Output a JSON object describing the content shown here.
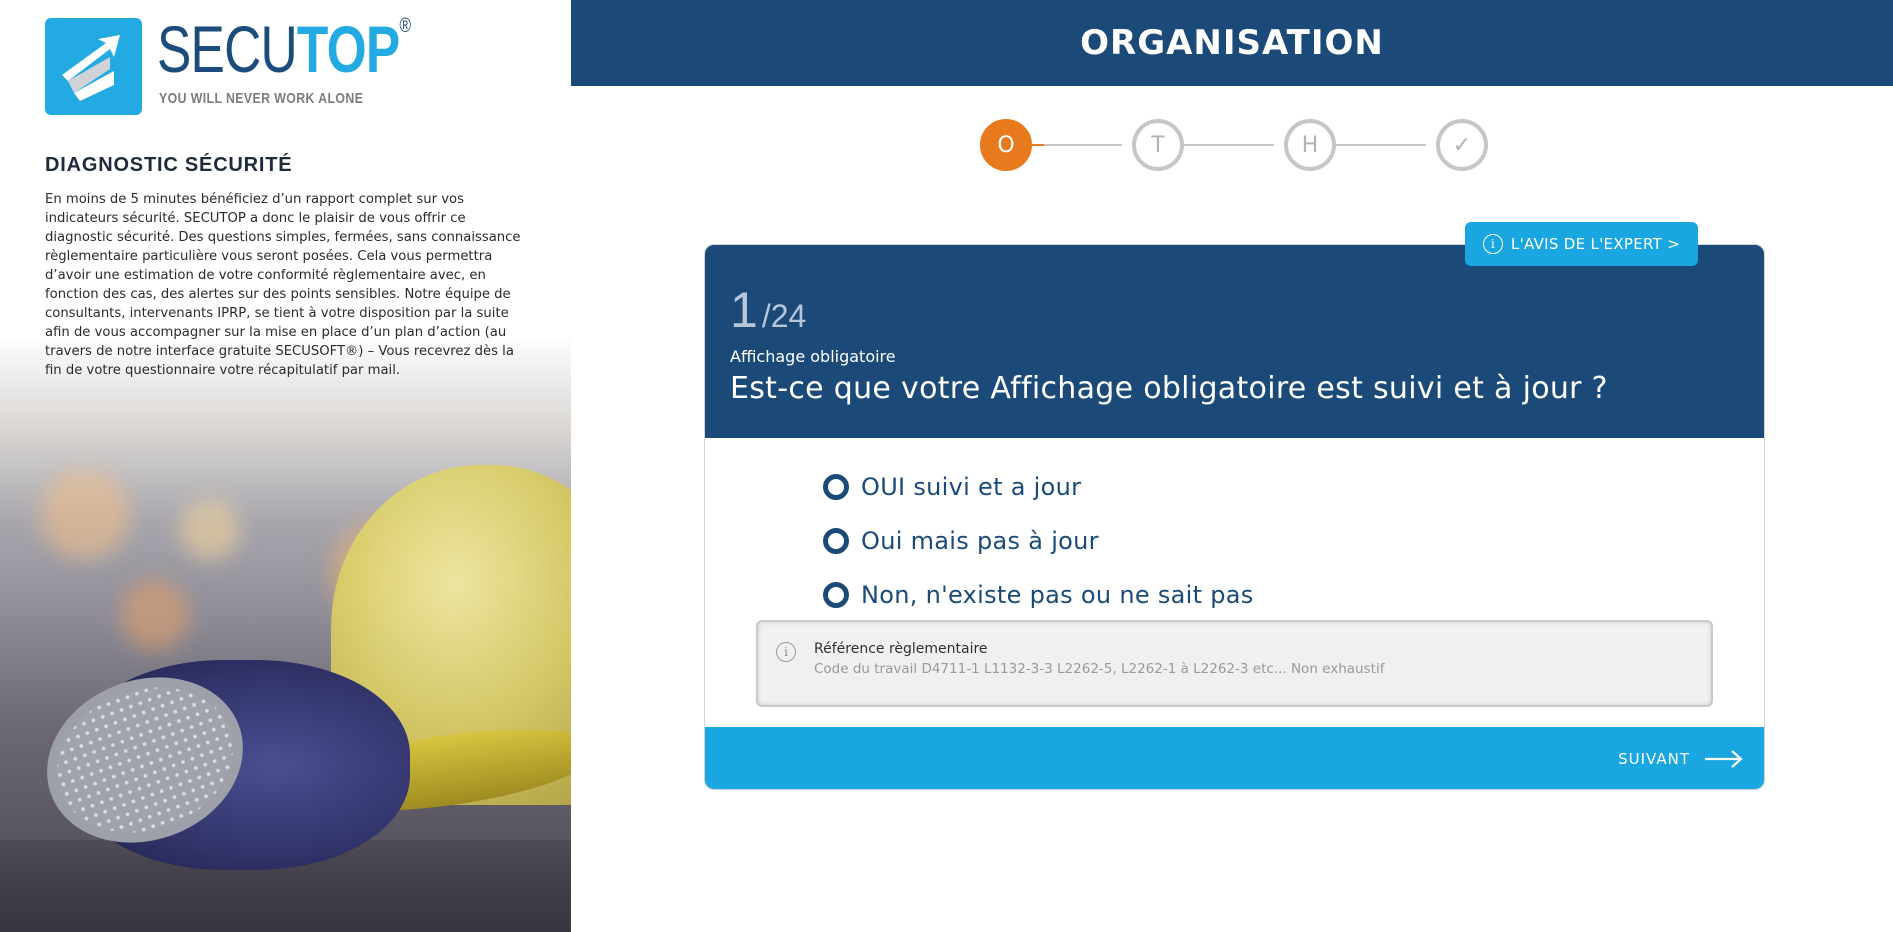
{
  "brand": {
    "word_a": "SECU",
    "word_b": "TOP",
    "registered": "®",
    "tagline": "YOU WILL NEVER WORK ALONE",
    "colors": {
      "dark_blue": "#1b4a78",
      "light_blue": "#23aae3",
      "orange": "#e87a1d"
    }
  },
  "sidebar": {
    "title": "DIAGNOSTIC SÉCURITÉ",
    "description": "En moins de 5 minutes bénéficiez d’un rapport complet sur vos indicateurs sécurité. SECUTOP a donc le plaisir de vous offrir ce diagnostic sécurité. Des questions simples, fermées, sans connaissance règlementaire particulière vous seront posées. Cela vous permettra d’avoir une estimation de votre conformité règlementaire avec, en fonction des cas, des alertes sur des points sensibles. Notre équipe de consultants, intervenants IPRP, se tient à votre disposition par la suite afin de vous accompagner sur la mise en place d’un plan d’action (au travers de notre interface gratuite SECUSOFT®) – Vous recevrez dès la fin de votre questionnaire votre récapitulatif par mail."
  },
  "header": {
    "title": "ORGANISATION"
  },
  "stepper": {
    "steps": [
      {
        "label": "O",
        "state": "active"
      },
      {
        "label": "T",
        "state": "inactive"
      },
      {
        "label": "H",
        "state": "inactive"
      },
      {
        "label": "✓",
        "state": "inactive"
      }
    ],
    "progress_first_segment": 0.13
  },
  "expert_button": {
    "icon": "info-icon",
    "label": "L'AVIS DE L'EXPERT >"
  },
  "question": {
    "current": "1",
    "total": "/24",
    "category": "Affichage obligatoire",
    "text": "Est-ce que votre Affichage obligatoire est suivi et à jour ?",
    "options": [
      {
        "label": "OUI suivi et a jour"
      },
      {
        "label": "Oui mais pas à jour"
      },
      {
        "label": "Non, n'existe pas ou ne sait pas"
      }
    ]
  },
  "reference": {
    "icon": "info-icon",
    "title": "Référence règlementaire",
    "body": "Code du travail D4711-1 L1132-3-3 L2262-5, L2262-1 à L2262-3 etc... Non exhaustif"
  },
  "footer": {
    "next_label": "SUIVANT",
    "next_icon": "arrow-right-icon"
  }
}
